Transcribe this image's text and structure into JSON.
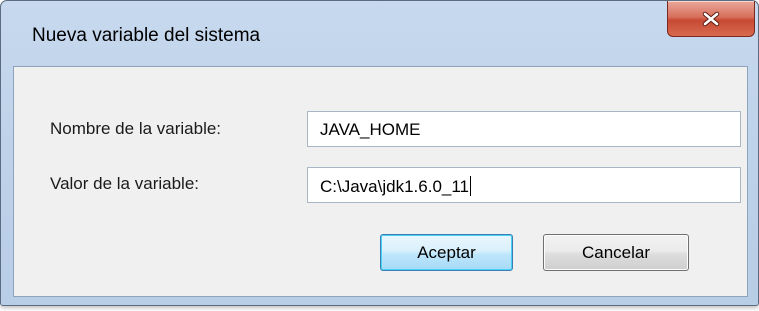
{
  "window": {
    "title": "Nueva variable del sistema",
    "close_icon": "close-icon"
  },
  "form": {
    "name_label": "Nombre de la variable:",
    "name_value": "JAVA_HOME",
    "value_label": "Valor de la variable:",
    "value_value": "C:\\Java\\jdk1.6.0_11"
  },
  "buttons": {
    "ok_label": "Aceptar",
    "cancel_label": "Cancelar"
  },
  "colors": {
    "close_button": "#c74a33",
    "frame": "#bfd3ea",
    "client": "#f0f0f0",
    "ok_focus": "#48d2f9"
  }
}
